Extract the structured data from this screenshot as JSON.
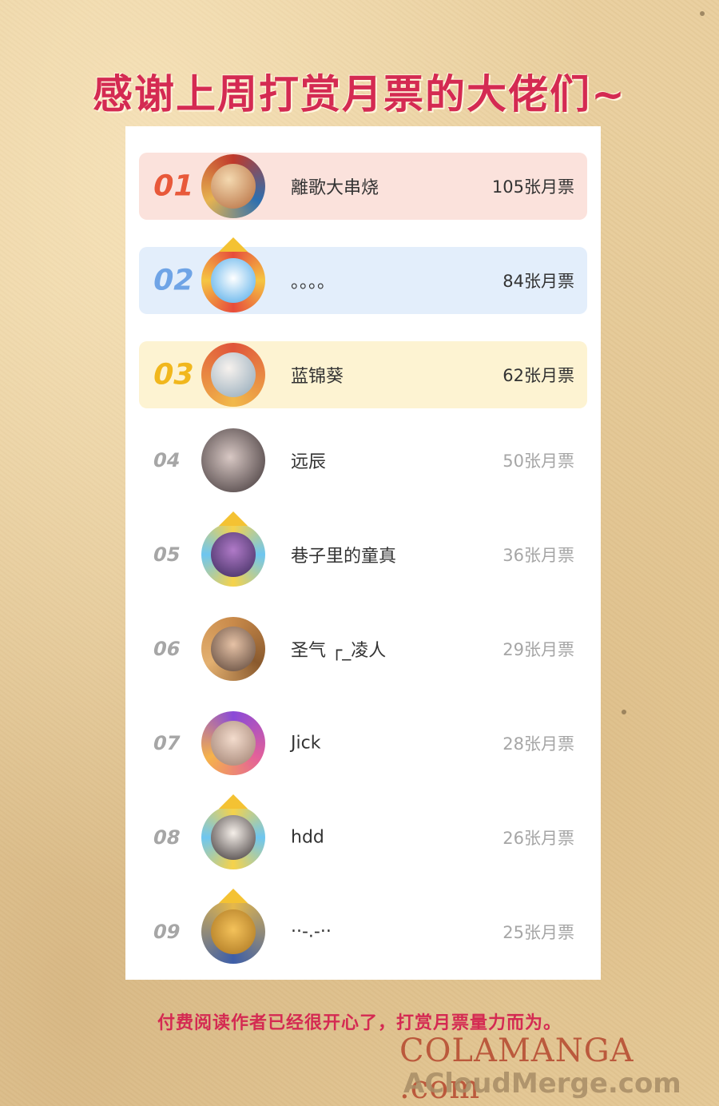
{
  "title": "感谢上周打赏月票的大佬们~",
  "ranking": [
    {
      "rank": "01",
      "name": "離歌大串烧",
      "votes": "105张月票",
      "bg": "#fbe2dc",
      "rank_color": "#e8593a"
    },
    {
      "rank": "02",
      "name": "。。。。",
      "votes": "84张月票",
      "bg": "#e3eefb",
      "rank_color": "#6fa4e6"
    },
    {
      "rank": "03",
      "name": "蓝锦葵",
      "votes": "62张月票",
      "bg": "#fdf3d2",
      "rank_color": "#f1b71d"
    },
    {
      "rank": "04",
      "name": "远辰",
      "votes": "50张月票"
    },
    {
      "rank": "05",
      "name": "巷子里的童真",
      "votes": "36张月票"
    },
    {
      "rank": "06",
      "name": "圣气 ┌_凌人",
      "votes": "29张月票"
    },
    {
      "rank": "07",
      "name": "Jick",
      "votes": "28张月票"
    },
    {
      "rank": "08",
      "name": "hdd",
      "votes": "26张月票"
    },
    {
      "rank": "09",
      "name": "··-.-··",
      "votes": "25张月票"
    }
  ],
  "footer": "付费阅读作者已经很开心了，打赏月票量力而为。",
  "watermark": {
    "line1": "COLAMANGA .com",
    "line2": "ACloudMerge.com"
  },
  "colors": {
    "accent": "#d42a52",
    "background": "#e9cf9e"
  }
}
